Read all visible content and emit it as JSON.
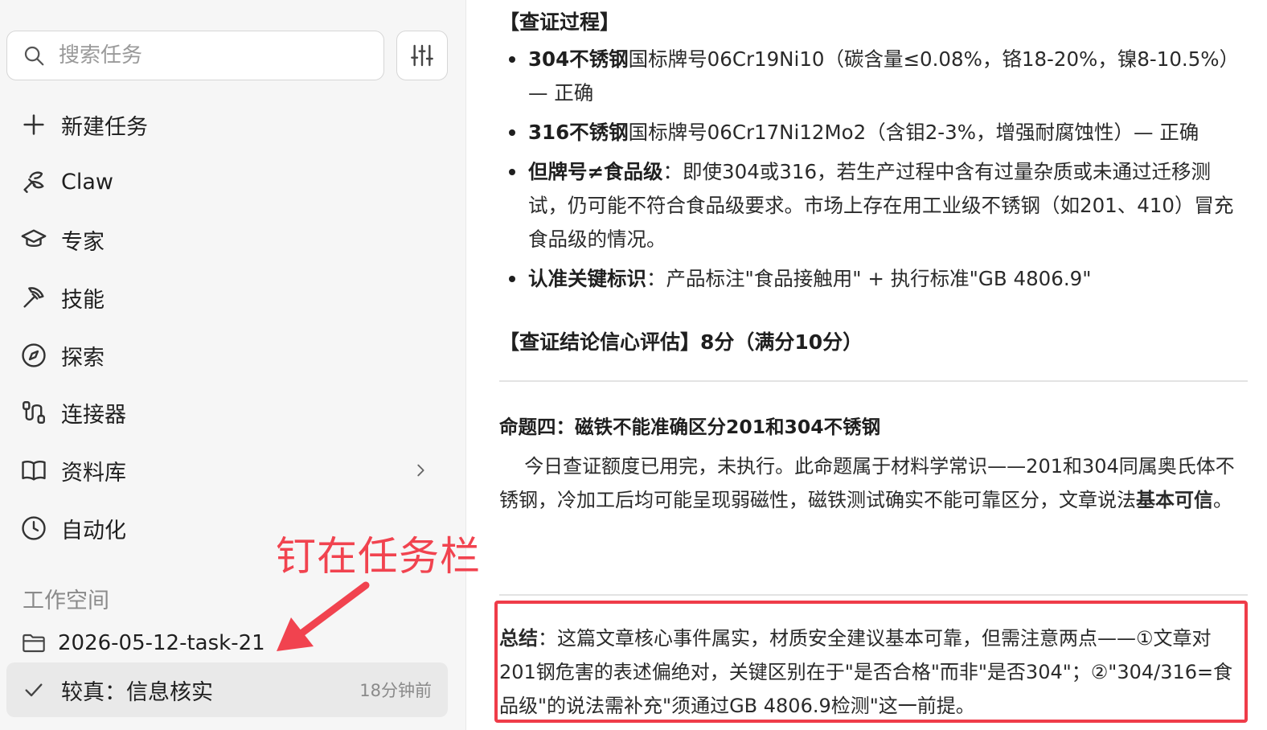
{
  "sidebar": {
    "search_placeholder": "搜索任务",
    "nav": [
      {
        "label": "新建任务",
        "icon": "plus-icon"
      },
      {
        "label": "Claw",
        "icon": "claw-icon"
      },
      {
        "label": "专家",
        "icon": "graduation-cap-icon"
      },
      {
        "label": "技能",
        "icon": "pickaxe-icon"
      },
      {
        "label": "探索",
        "icon": "compass-icon"
      },
      {
        "label": "连接器",
        "icon": "connector-icon"
      },
      {
        "label": "资料库",
        "icon": "book-icon"
      },
      {
        "label": "自动化",
        "icon": "clock-icon"
      }
    ],
    "workspace_title": "工作空间",
    "workspace_folder": "2026-05-12-task-21",
    "task": {
      "label": "较真：信息核实",
      "time": "18分钟前"
    }
  },
  "annotation": {
    "text": "钉在任务栏",
    "color": "#f1434f"
  },
  "main": {
    "verify_heading": "【查证过程】",
    "bullets": [
      {
        "bold": "304不锈钢",
        "text": "国标牌号06Cr19Ni10（碳含量≤0.08%，铬18-20%，镍8-10.5%）— 正确"
      },
      {
        "bold": "316不锈钢",
        "text": "国标牌号06Cr17Ni12Mo2（含钼2-3%，增强耐腐蚀性）— 正确"
      },
      {
        "bold": "但牌号≠食品级",
        "text": "：即使304或316，若生产过程中含有过量杂质或未通过迁移测试，仍可能不符合食品级要求。市场上存在用工业级不锈钢（如201、410）冒充食品级的情况。"
      },
      {
        "bold": "认准关键标识",
        "text": "：产品标注\"食品接触用\" + 执行标准\"GB 4806.9\""
      }
    ],
    "confidence": "【查证结论信心评估】8分（满分10分）",
    "proposition_title": "命题四：磁铁不能准确区分201和304不锈钢",
    "proposition_text": "今日查证额度已用完，未执行。此命题属于材料学常识——201和304同属奥氏体不锈钢，冷加工后均可能呈现弱磁性，磁铁测试确实不能可靠区分，文章说法",
    "proposition_bold": "基本可信",
    "proposition_end": "。",
    "summary_bold": "总结",
    "summary_text": "：这篇文章核心事件属实，材质安全建议基本可靠，但需注意两点——①文章对201钢危害的表述偏绝对，关键区别在于\"是否合格\"而非\"是否304\"；②\"304/316=食品级\"的说法需补充\"须通过GB 4806.9检测\"这一前提。",
    "highlight_color": "#ef3c49"
  }
}
